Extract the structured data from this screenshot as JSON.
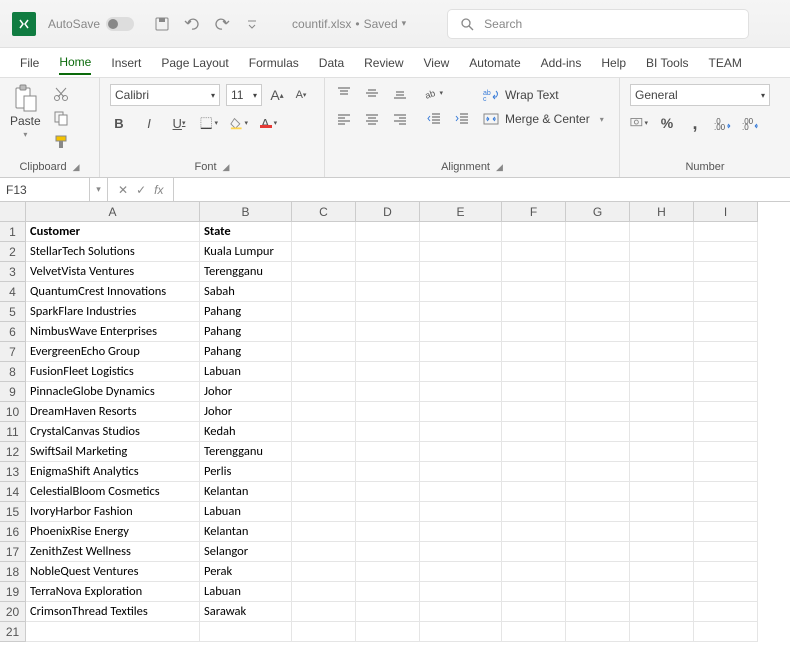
{
  "titlebar": {
    "autosave_label": "AutoSave",
    "filename": "countif.xlsx",
    "saved_label": "Saved",
    "search_placeholder": "Search"
  },
  "menubar": {
    "items": [
      "File",
      "Home",
      "Insert",
      "Page Layout",
      "Formulas",
      "Data",
      "Review",
      "View",
      "Automate",
      "Add-ins",
      "Help",
      "BI Tools",
      "TEAM"
    ],
    "active_index": 1
  },
  "ribbon": {
    "clipboard": {
      "paste_label": "Paste",
      "group_label": "Clipboard"
    },
    "font": {
      "font_name": "Calibri",
      "font_size": "11",
      "group_label": "Font"
    },
    "alignment": {
      "wrap_label": "Wrap Text",
      "merge_label": "Merge & Center",
      "group_label": "Alignment"
    },
    "number": {
      "format": "General",
      "group_label": "Number"
    }
  },
  "namebox": {
    "value": "F13"
  },
  "formula": {
    "value": ""
  },
  "grid": {
    "columns": [
      "A",
      "B",
      "C",
      "D",
      "E",
      "F",
      "G",
      "H",
      "I"
    ],
    "rows": [
      {
        "n": 1,
        "a": "Customer",
        "b": "State",
        "header": true
      },
      {
        "n": 2,
        "a": "StellarTech Solutions",
        "b": "Kuala Lumpur"
      },
      {
        "n": 3,
        "a": "VelvetVista Ventures",
        "b": "Terengganu"
      },
      {
        "n": 4,
        "a": "QuantumCrest Innovations",
        "b": "Sabah"
      },
      {
        "n": 5,
        "a": "SparkFlare Industries",
        "b": "Pahang"
      },
      {
        "n": 6,
        "a": "NimbusWave Enterprises",
        "b": "Pahang"
      },
      {
        "n": 7,
        "a": "EvergreenEcho Group",
        "b": "Pahang"
      },
      {
        "n": 8,
        "a": "FusionFleet Logistics",
        "b": "Labuan"
      },
      {
        "n": 9,
        "a": "PinnacleGlobe Dynamics",
        "b": "Johor"
      },
      {
        "n": 10,
        "a": "DreamHaven Resorts",
        "b": "Johor"
      },
      {
        "n": 11,
        "a": "CrystalCanvas Studios",
        "b": "Kedah"
      },
      {
        "n": 12,
        "a": "SwiftSail Marketing",
        "b": "Terengganu"
      },
      {
        "n": 13,
        "a": "EnigmaShift Analytics",
        "b": "Perlis"
      },
      {
        "n": 14,
        "a": "CelestialBloom Cosmetics",
        "b": "Kelantan"
      },
      {
        "n": 15,
        "a": "IvoryHarbor Fashion",
        "b": "Labuan"
      },
      {
        "n": 16,
        "a": "PhoenixRise Energy",
        "b": "Kelantan"
      },
      {
        "n": 17,
        "a": "ZenithZest Wellness",
        "b": "Selangor"
      },
      {
        "n": 18,
        "a": "NobleQuest Ventures",
        "b": "Perak"
      },
      {
        "n": 19,
        "a": "TerraNova Exploration",
        "b": "Labuan"
      },
      {
        "n": 20,
        "a": "CrimsonThread Textiles",
        "b": "Sarawak"
      },
      {
        "n": 21,
        "a": "",
        "b": ""
      }
    ]
  }
}
